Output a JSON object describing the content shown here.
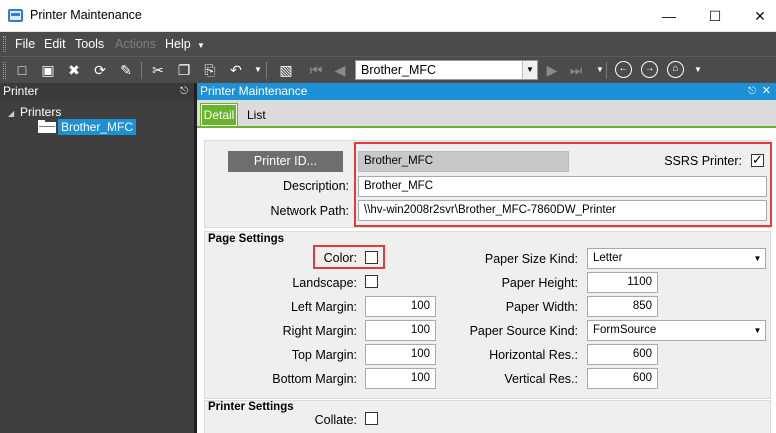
{
  "window": {
    "title": "Printer Maintenance",
    "minimize": "—",
    "maximize": "☐",
    "close": "✕"
  },
  "menu": {
    "file": "File",
    "edit": "Edit",
    "tools": "Tools",
    "actions": "Actions",
    "help": "Help"
  },
  "toolbar": {
    "selected_record": "Brother_MFC"
  },
  "left_panel": {
    "header": "Printer",
    "tree_root": "Printers",
    "tree_item": "Brother_MFC"
  },
  "right_panel": {
    "header": "Printer Maintenance",
    "tabs": {
      "detail": "Detail",
      "list": "List"
    }
  },
  "form": {
    "printer_id_label": "Printer ID...",
    "printer_id_value": "Brother_MFC",
    "ssrs_label": "SSRS Printer:",
    "ssrs_checked": true,
    "description_label": "Description:",
    "description_value": "Brother_MFC",
    "network_path_label": "Network Path:",
    "network_path_value": "\\\\hv-win2008r2svr\\Brother_MFC-7860DW_Printer"
  },
  "page_settings": {
    "title": "Page Settings",
    "color_label": "Color:",
    "landscape_label": "Landscape:",
    "left_margin_label": "Left Margin:",
    "left_margin": "100",
    "right_margin_label": "Right Margin:",
    "right_margin": "100",
    "top_margin_label": "Top Margin:",
    "top_margin": "100",
    "bottom_margin_label": "Bottom Margin:",
    "bottom_margin": "100",
    "paper_size_kind_label": "Paper Size Kind:",
    "paper_size_kind": "Letter",
    "paper_height_label": "Paper Height:",
    "paper_height": "1100",
    "paper_width_label": "Paper Width:",
    "paper_width": "850",
    "paper_source_kind_label": "Paper Source Kind:",
    "paper_source_kind": "FormSource",
    "horizontal_res_label": "Horizontal Res.:",
    "horizontal_res": "600",
    "vertical_res_label": "Vertical Res.:",
    "vertical_res": "600"
  },
  "printer_settings": {
    "title": "Printer Settings",
    "collate_label": "Collate:"
  },
  "colors": {
    "accent_blue": "#1e90d6",
    "tab_green": "#6ab42d",
    "highlight_red": "#e23b3b",
    "dark_chrome": "#4b4b4b"
  }
}
